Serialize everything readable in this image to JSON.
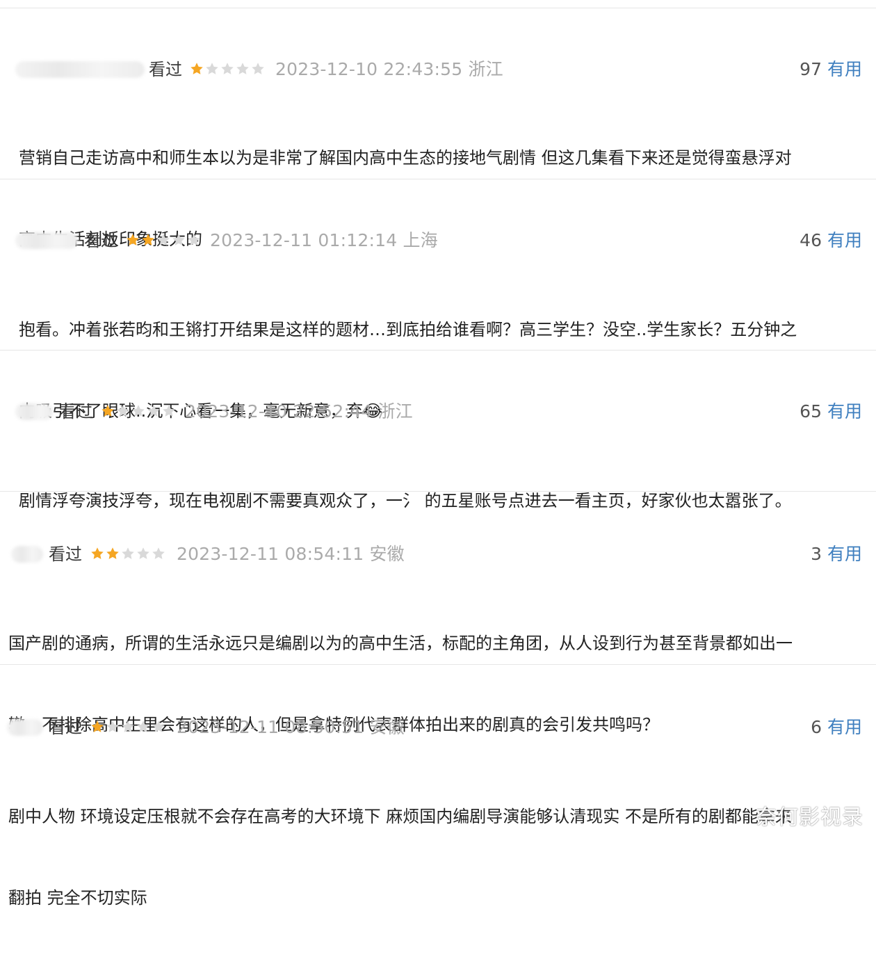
{
  "reviews": [
    {
      "watched_label": "看过",
      "rating": 1,
      "max_rating": 5,
      "datetime": "2023-12-10 22:43:55 浙江",
      "useful_count": "97",
      "useful_label": "有用",
      "comment_line1": "营销自己走访高中和师生本以为是非常了解国内高中生态的接地气剧情 但这几集看下来还是觉得蛮悬浮对",
      "comment_line2": "高中生活刻板印象挺大的"
    },
    {
      "watched_label": "看过",
      "rating": 2,
      "max_rating": 5,
      "datetime": "2023-12-11 01:12:14 上海",
      "useful_count": "46",
      "useful_label": "有用",
      "comment_line1": "抱看。冲着张若昀和王锵打开结果是这样的题材…到底拍给谁看啊？高三学生？没空..学生家长？五分钟之",
      "comment_line2": "内吸引不了眼球..沉下心看一集，毫无新意，弃😂"
    },
    {
      "watched_label": "看过",
      "rating": 1,
      "max_rating": 5,
      "datetime": "2023-12-10 22:52:44 浙江",
      "useful_count": "65",
      "useful_label": "有用",
      "comment_line1": "剧情浮夸演技浮夸，现在电视剧不需要真观众了，一氵 的五星账号点进去一看主页，好家伙也太嚣张了。"
    },
    {
      "watched_label": "看过",
      "rating": 2,
      "max_rating": 5,
      "datetime": "2023-12-11 08:54:11 安徽",
      "useful_count": "3",
      "useful_label": "有用",
      "comment_line1": "国产剧的通病，所谓的生活永远只是编剧以为的高中生活，标配的主角团，从人设到行为甚至背景都如出一",
      "comment_line2": "辙，不排除高中生里会有这样的人，但是拿特例代表群体拍出来的剧真的会引发共鸣吗？"
    },
    {
      "watched_label": "看过",
      "rating": 1,
      "max_rating": 5,
      "datetime": "2023-12-11 08:50:51 安徽",
      "useful_count": "6",
      "useful_label": "有用",
      "comment_line1": "剧中人物 环境设定压根就不会存在高考的大环境下 麻烦国内编剧导演能够认清现实 不是所有的剧都能拿来",
      "comment_line2": "翻拍 完全不切实际"
    }
  ],
  "watermark": "奈何影视录",
  "colors": {
    "star_filled": "#f5a623",
    "star_empty": "#d9d9d9",
    "useful_link": "#3f7fbf",
    "datetime": "#aaaaaa"
  }
}
